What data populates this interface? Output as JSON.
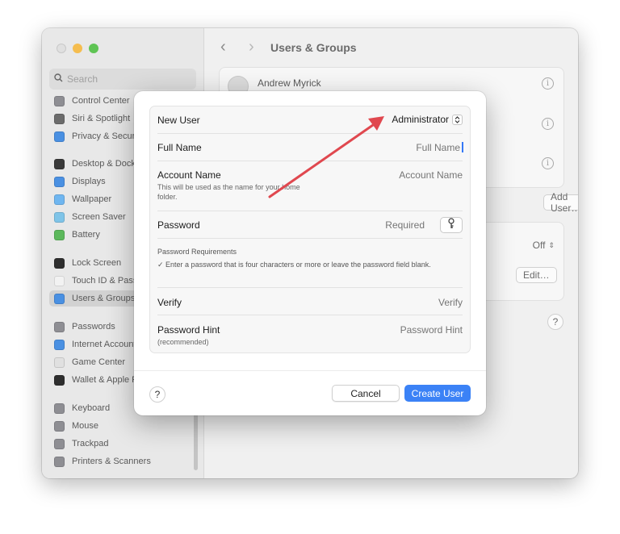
{
  "window": {
    "title": "Users & Groups",
    "search_placeholder": "Search"
  },
  "sidebar": {
    "items": [
      {
        "label": "Control Center",
        "icon": "control-center-icon",
        "color": "#8e8e93"
      },
      {
        "label": "Siri & Spotlight",
        "icon": "siri-icon",
        "color": "#6b6b6b"
      },
      {
        "label": "Privacy & Security",
        "icon": "hand-icon",
        "color": "#4a90e2"
      },
      {
        "label": "Desktop & Dock",
        "icon": "dock-icon",
        "color": "#3a3a3a"
      },
      {
        "label": "Displays",
        "icon": "display-icon",
        "color": "#4a90e2"
      },
      {
        "label": "Wallpaper",
        "icon": "wallpaper-icon",
        "color": "#6fb6f0"
      },
      {
        "label": "Screen Saver",
        "icon": "screen-saver-icon",
        "color": "#7fc4e8"
      },
      {
        "label": "Battery",
        "icon": "battery-icon",
        "color": "#5cb85c"
      },
      {
        "label": "Lock Screen",
        "icon": "lock-icon",
        "color": "#2e2e2e"
      },
      {
        "label": "Touch ID & Password",
        "icon": "fingerprint-icon",
        "color": "#f2f2f2"
      },
      {
        "label": "Users & Groups",
        "icon": "users-icon",
        "color": "#4a90e2"
      },
      {
        "label": "Passwords",
        "icon": "key-icon",
        "color": "#8e8e93"
      },
      {
        "label": "Internet Accounts",
        "icon": "at-icon",
        "color": "#4a90e2"
      },
      {
        "label": "Game Center",
        "icon": "game-center-icon",
        "color": "#e0e0e0"
      },
      {
        "label": "Wallet & Apple Pay",
        "icon": "wallet-icon",
        "color": "#2e2e2e"
      },
      {
        "label": "Keyboard",
        "icon": "keyboard-icon",
        "color": "#8e8e93"
      },
      {
        "label": "Mouse",
        "icon": "mouse-icon",
        "color": "#8e8e93"
      },
      {
        "label": "Trackpad",
        "icon": "trackpad-icon",
        "color": "#8e8e93"
      },
      {
        "label": "Printers & Scanners",
        "icon": "printer-icon",
        "color": "#8e8e93"
      }
    ],
    "selected": "Users & Groups"
  },
  "content": {
    "user_name": "Andrew Myrick",
    "add_user_label": "Add User…",
    "auto_login_value": "Off",
    "edit_label": "Edit…",
    "help_label": "?"
  },
  "dialog": {
    "new_user_label": "New User",
    "account_type": "Administrator",
    "full_name_label": "Full Name",
    "full_name_placeholder": "Full Name",
    "account_name_label": "Account Name",
    "account_name_desc": "This will be used as the name for your home folder.",
    "account_name_placeholder": "Account Name",
    "password_label": "Password",
    "password_placeholder": "Required",
    "password_req_title": "Password Requirements",
    "password_req_text": "✓ Enter a password that is four characters or more or leave the password field blank.",
    "verify_label": "Verify",
    "verify_placeholder": "Verify",
    "hint_label": "Password Hint",
    "hint_sub": "(recommended)",
    "hint_placeholder": "Password Hint",
    "help_label": "?",
    "cancel_label": "Cancel",
    "create_label": "Create User"
  },
  "colors": {
    "accent": "#3b82f6",
    "annotation_arrow": "#e0484f"
  }
}
